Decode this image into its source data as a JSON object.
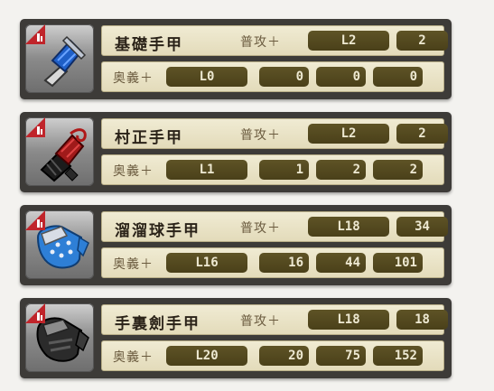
{
  "labels": {
    "normal_attack": "普攻＋",
    "secret_art": "奥義＋"
  },
  "colors": {
    "card_bg": "#3d3b38",
    "row_bg": "#ece6c9",
    "pill_bg": "#564b21",
    "pill_text": "#eee9d2",
    "badge": "#c0242a"
  },
  "items": [
    {
      "name": "基礎手甲",
      "icon": "blue-gauntlet-icon",
      "normal_level": "L2",
      "normal_value": "2",
      "secret_level": "L0",
      "secret_values": [
        "0",
        "0",
        "0"
      ]
    },
    {
      "name": "村正手甲",
      "icon": "red-black-gauntlet-icon",
      "normal_level": "L2",
      "normal_value": "2",
      "secret_level": "L1",
      "secret_values": [
        "1",
        "2",
        "2"
      ]
    },
    {
      "name": "溜溜球手甲",
      "icon": "blue-studded-glove-icon",
      "normal_level": "L18",
      "normal_value": "34",
      "secret_level": "L16",
      "secret_values": [
        "16",
        "44",
        "101"
      ]
    },
    {
      "name": "手裏劍手甲",
      "icon": "black-glove-icon",
      "normal_level": "L18",
      "normal_value": "18",
      "secret_level": "L20",
      "secret_values": [
        "20",
        "75",
        "152"
      ]
    }
  ]
}
